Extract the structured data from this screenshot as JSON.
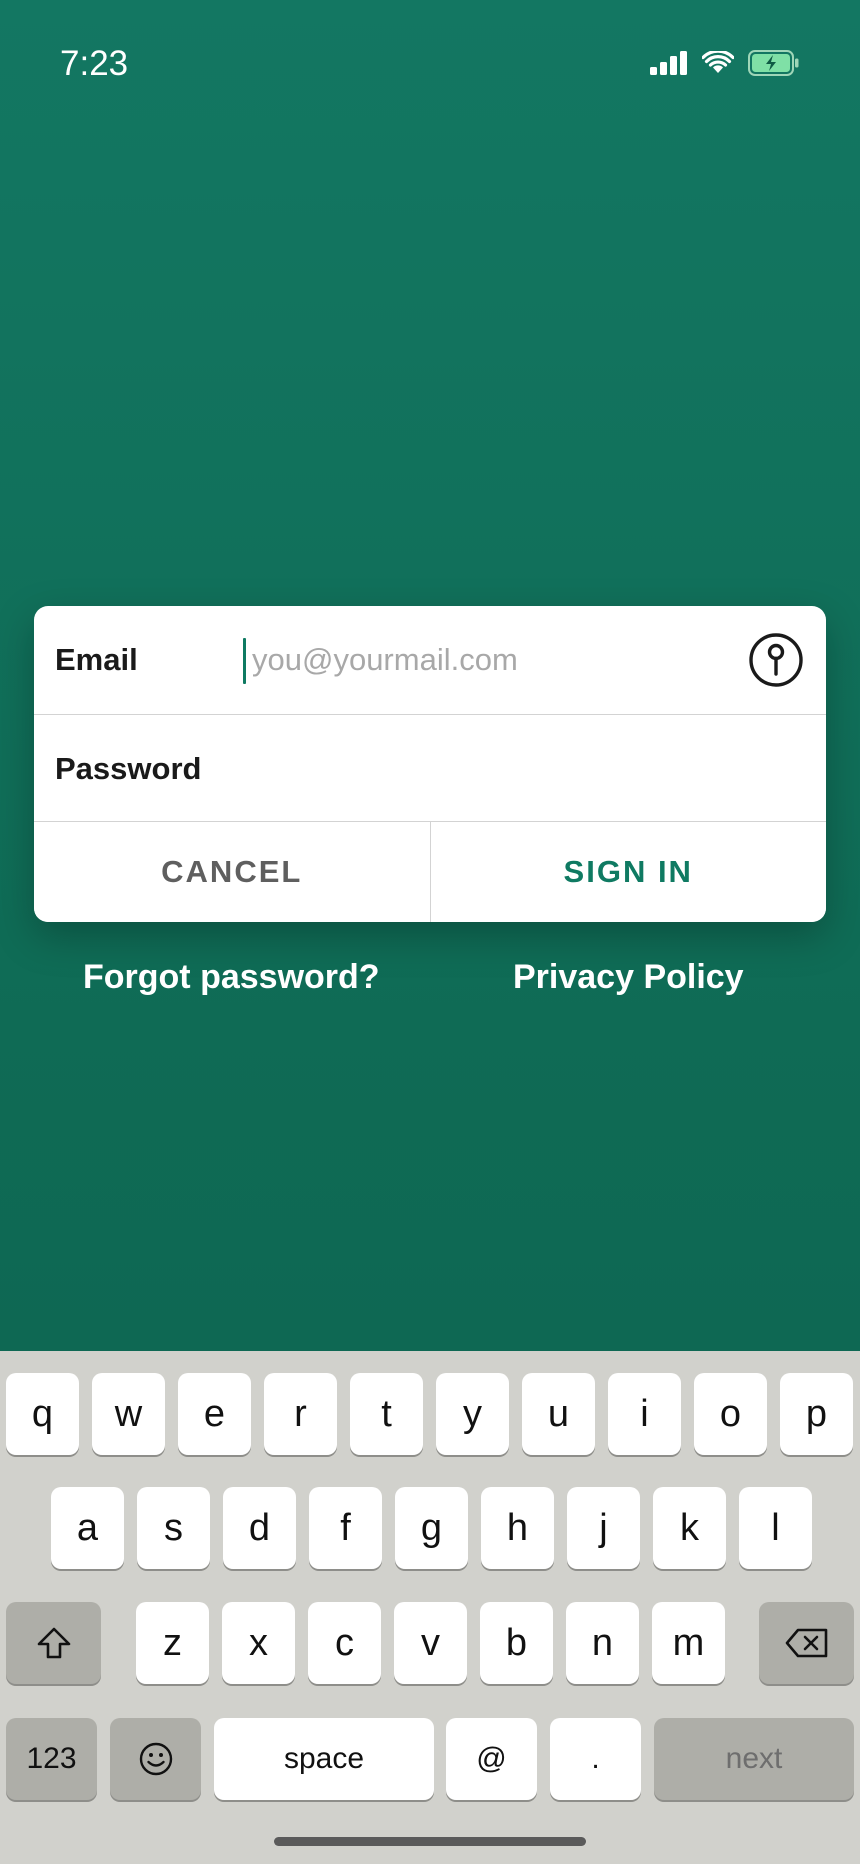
{
  "status_bar": {
    "time": "7:23",
    "icons": [
      "cellular-signal-icon",
      "wifi-icon",
      "battery-charging-icon"
    ]
  },
  "login_dialog": {
    "email_label": "Email",
    "email_placeholder": "you@yourmail.com",
    "email_value": "",
    "password_label": "Password",
    "password_value": "",
    "key_icon": "key-icon",
    "cancel_label": "CANCEL",
    "sign_in_label": "SIGN IN"
  },
  "links": {
    "forgot_password": "Forgot password?",
    "privacy_policy": "Privacy Policy"
  },
  "keyboard": {
    "row1": [
      "q",
      "w",
      "e",
      "r",
      "t",
      "y",
      "u",
      "i",
      "o",
      "p"
    ],
    "row2": [
      "a",
      "s",
      "d",
      "f",
      "g",
      "h",
      "j",
      "k",
      "l"
    ],
    "row3": [
      "z",
      "x",
      "c",
      "v",
      "b",
      "n",
      "m"
    ],
    "numbers_label": "123",
    "space_label": "space",
    "at_label": "@",
    "period_label": ".",
    "next_label": "next",
    "shift_icon": "shift-icon",
    "delete_icon": "backspace-icon",
    "emoji_icon": "emoji-icon"
  },
  "colors": {
    "background": "#137762",
    "accent": "#0f7a62",
    "keyboard": "#d1d1cc"
  }
}
